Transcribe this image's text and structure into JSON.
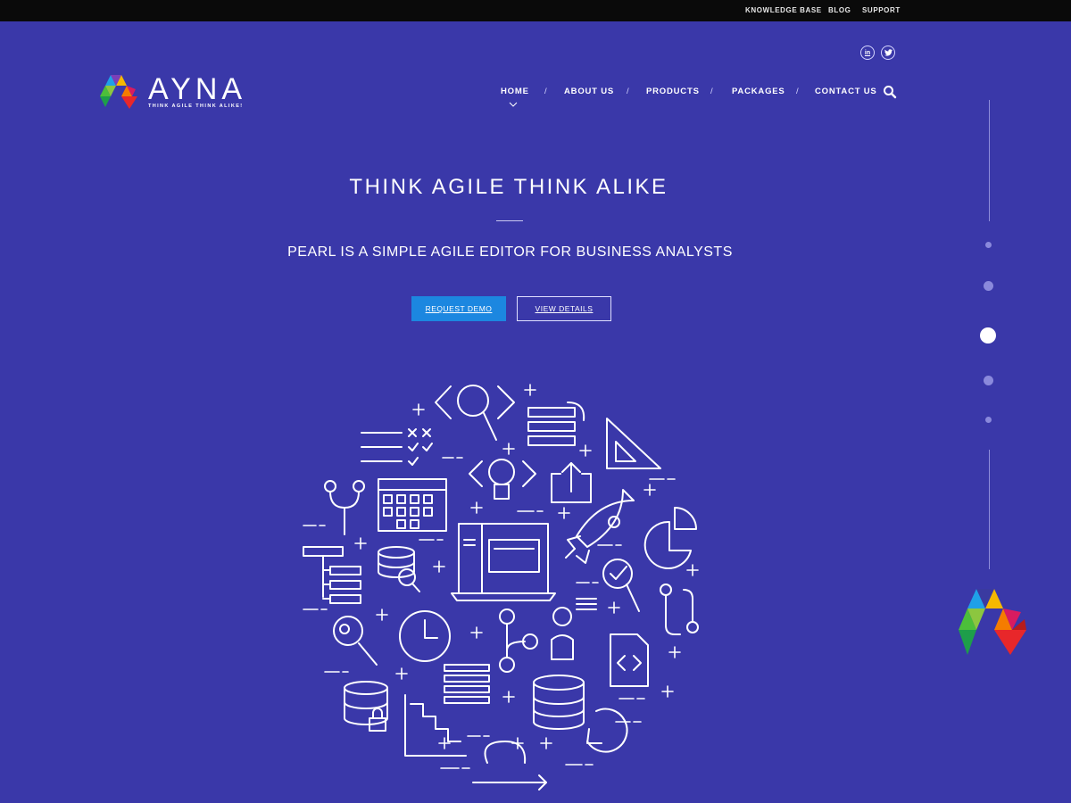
{
  "topbar": {
    "links": [
      "KNOWLEDGE BASE",
      "BLOG",
      "SUPPORT"
    ]
  },
  "social": {
    "linkedin": "in",
    "twitter": "t"
  },
  "brand": {
    "name": "AYNA",
    "tagline": "THINK AGILE THINK ALIKE!"
  },
  "nav": {
    "items": [
      "HOME",
      "ABOUT US",
      "PRODUCTS",
      "PACKAGES",
      "CONTACT US"
    ],
    "separator": "/",
    "active": "HOME"
  },
  "hero": {
    "title": "THINK AGILE THINK ALIKE",
    "subtitle": "PEARL IS A SIMPLE AGILE EDITOR FOR BUSINESS ANALYSTS",
    "primary_button": "REQUEST DEMO",
    "secondary_button": "VIEW DETAILS"
  },
  "slider": {
    "slide_count": 5,
    "active_index": 2
  },
  "icons": {
    "search": "search-icon",
    "linkedin": "linkedin-icon",
    "twitter": "twitter-icon",
    "caret": "chevron-down-icon"
  },
  "colors": {
    "background": "#3a38a9",
    "topbar": "#0a0a0a",
    "primary_button": "#1c87e0",
    "logo_blue": "#1fa0e8",
    "logo_green": "#4cbf3a",
    "logo_yellow": "#f5b800",
    "logo_red": "#e8272a",
    "logo_purple": "#7b3fb8"
  }
}
